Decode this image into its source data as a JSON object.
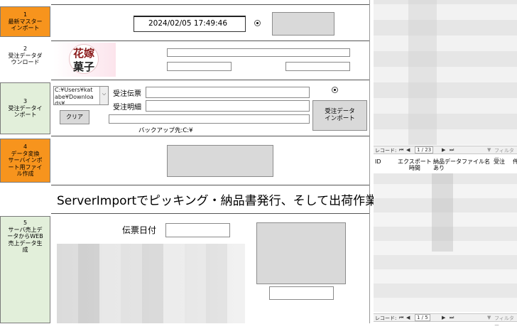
{
  "sections": {
    "s1": {
      "label": "1\n最新マスター\nインポート",
      "datetime": "2024/02/05 17:49:46"
    },
    "s2": {
      "label": "2\n受注データダ\nウンロード",
      "logo_top": "花嫁",
      "logo_bottom": "菓子"
    },
    "s3": {
      "label": "3\n受注データイ\nンポート",
      "path_text": "C:¥Users¥kat\nabe¥Downloa\nds¥",
      "order_slip_label": "受注伝票",
      "order_detail_label": "受注明細",
      "clear_button": "クリア",
      "import_button": "受注データ\nインポート",
      "backup_label": "バックアップ先:C:¥"
    },
    "s4": {
      "label": "4\nデータ変換\nサーバインポ\nート用ファイ\nル作成"
    },
    "banner": "ServerImportでピッキング・納品書発行、そして出荷作業",
    "s5": {
      "label": "5\nサーバ売上デ\nータからWEB\n売上データ生\n成",
      "slip_date_label": "伝票日付"
    }
  },
  "right_pane": {
    "top_nav": {
      "record_label": "レコード:",
      "position": "1 / 23",
      "filter_label": "フィルター"
    },
    "columns": [
      "ID",
      "エクスポート\n時間",
      "納品\nあり",
      "データファイル名",
      "受注",
      "件"
    ],
    "bottom_nav": {
      "record_label": "レコード:",
      "position": "1 / 5",
      "filter_label": "フィルター"
    }
  },
  "colors": {
    "orange": "#f7941d",
    "green": "#e2efda",
    "button_gray": "#d9d9d9"
  }
}
